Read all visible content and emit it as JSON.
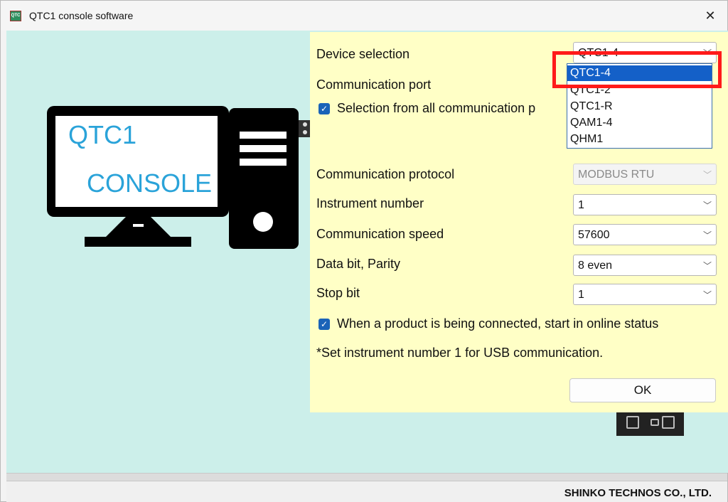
{
  "window": {
    "title": "QTC1 console software",
    "icon_label": "QTC"
  },
  "illustration": {
    "screen_title": "QTC1",
    "screen_subtitle": "CONSOLE"
  },
  "form": {
    "device_selection": {
      "label": "Device selection",
      "value": "QTC1-4"
    },
    "communication_port": {
      "label": "Communication port"
    },
    "select_all_ports": {
      "label": "Selection from all communication p",
      "checked": true
    },
    "communication_protocol": {
      "label": "Communication protocol",
      "value": "MODBUS RTU",
      "enabled": false
    },
    "instrument_number": {
      "label": "Instrument number",
      "value": "1"
    },
    "communication_speed": {
      "label": "Communication speed",
      "value": "57600"
    },
    "data_bit_parity": {
      "label": "Data bit, Parity",
      "value": "8 even"
    },
    "stop_bit": {
      "label": "Stop bit",
      "value": "1"
    },
    "online_on_connect": {
      "label": "When a product is being connected, start in online status",
      "checked": true
    },
    "note": "*Set instrument number 1 for USB communication.",
    "ok_label": "OK"
  },
  "device_dropdown": {
    "options": [
      "QTC1-4",
      "QTC1-2",
      "QTC1-R",
      "QAM1-4",
      "QHM1"
    ],
    "selected": "QTC1-4"
  },
  "footer": {
    "company": "SHINKO TECHNOS CO., LTD."
  },
  "colors": {
    "background": "#ccefea",
    "panel": "#ffffc6",
    "highlight": "#ff1a1a",
    "selected": "#1460c8",
    "screen_text": "#2aa3d9"
  }
}
